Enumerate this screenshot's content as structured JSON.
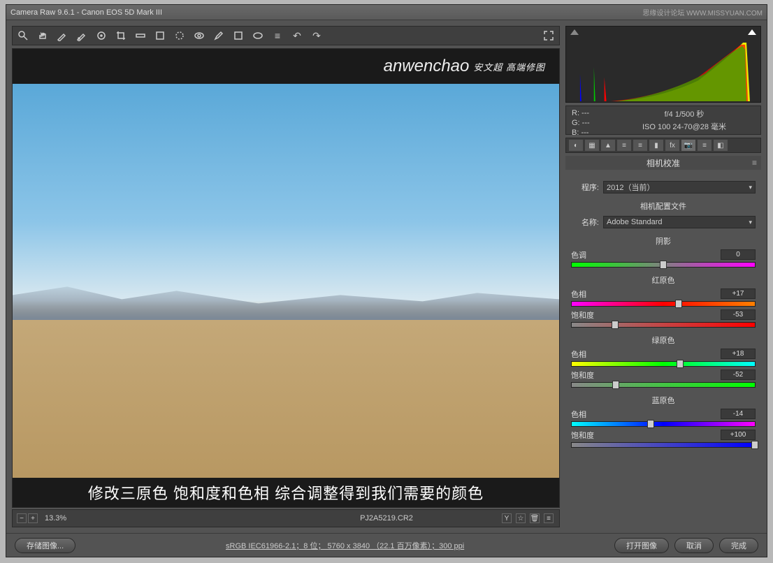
{
  "app": {
    "title": "Camera Raw 9.6.1  -  Canon EOS 5D Mark III",
    "site": "思缘设计论坛 WWW.MISSYUAN.COM"
  },
  "watermark": {
    "script": "anwenchao",
    "cn": "安文超 高端修图"
  },
  "caption": "修改三原色  饱和度和色相  综合调整得到我们需要的颜色",
  "zoom": "13.3%",
  "filename": "PJ2A5219.CR2",
  "meta": {
    "r": "R:  ---",
    "g": "G:  ---",
    "b": "B:  ---",
    "exp": "f/4  1/500 秒",
    "iso": "ISO 100   24-70@28 毫米"
  },
  "panel_title": "相机校准",
  "process": {
    "label": "程序:",
    "value": "2012（当前）"
  },
  "profile": {
    "title": "相机配置文件",
    "label": "名称:",
    "value": "Adobe Standard"
  },
  "shadows": {
    "title": "阴影",
    "tint_label": "色调",
    "tint_val": "0"
  },
  "red": {
    "title": "红原色",
    "hue_label": "色相",
    "hue_val": "+17",
    "sat_label": "饱和度",
    "sat_val": "-53"
  },
  "green": {
    "title": "绿原色",
    "hue_label": "色相",
    "hue_val": "+18",
    "sat_label": "饱和度",
    "sat_val": "-52"
  },
  "blue": {
    "title": "蓝原色",
    "hue_label": "色相",
    "hue_val": "-14",
    "sat_label": "饱和度",
    "sat_val": "+100"
  },
  "footer": {
    "save": "存储图像...",
    "info": "sRGB IEC61966-2.1；8 位； 5760 x 3840 （22.1 百万像素）；300 ppi",
    "open": "打开图像",
    "cancel": "取消",
    "done": "完成"
  }
}
